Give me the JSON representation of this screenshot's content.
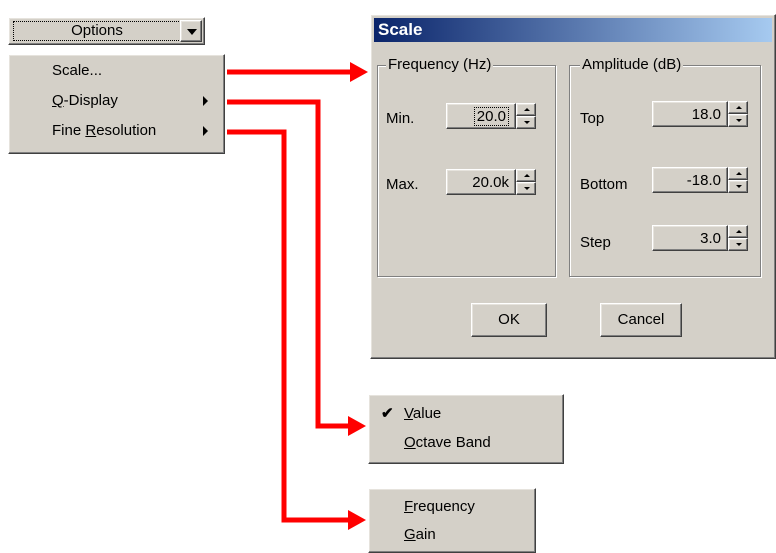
{
  "options_combo": {
    "label": "Options"
  },
  "options_menu": {
    "items": [
      {
        "pre": "",
        "ul": "",
        "post": "Scale...",
        "submenu": false
      },
      {
        "pre": "",
        "ul": "Q",
        "post": "-Display",
        "submenu": true
      },
      {
        "pre": "Fine ",
        "ul": "R",
        "post": "esolution",
        "submenu": true
      }
    ]
  },
  "scale_dialog": {
    "title": "Scale",
    "frequency": {
      "legend": "Frequency (Hz)",
      "min_label": "Min.",
      "min_value": "20.0",
      "max_label": "Max.",
      "max_value": "20.0k"
    },
    "amplitude": {
      "legend": "Amplitude (dB)",
      "top_label": "Top",
      "top_value": "18.0",
      "bottom_label": "Bottom",
      "bottom_value": "-18.0",
      "step_label": "Step",
      "step_value": "3.0"
    },
    "ok_label": "OK",
    "cancel_label": "Cancel"
  },
  "q_display_menu": {
    "items": [
      {
        "ul": "V",
        "post": "alue",
        "checked": true
      },
      {
        "ul": "O",
        "post": "ctave Band",
        "checked": false
      }
    ]
  },
  "fine_resolution_menu": {
    "items": [
      {
        "ul": "F",
        "post": "requency"
      },
      {
        "ul": "G",
        "post": "ain"
      }
    ]
  },
  "colors": {
    "arrow": "#ff0000",
    "face": "#d4d0c8",
    "title_start": "#0a246a",
    "title_end": "#a6caf0"
  }
}
